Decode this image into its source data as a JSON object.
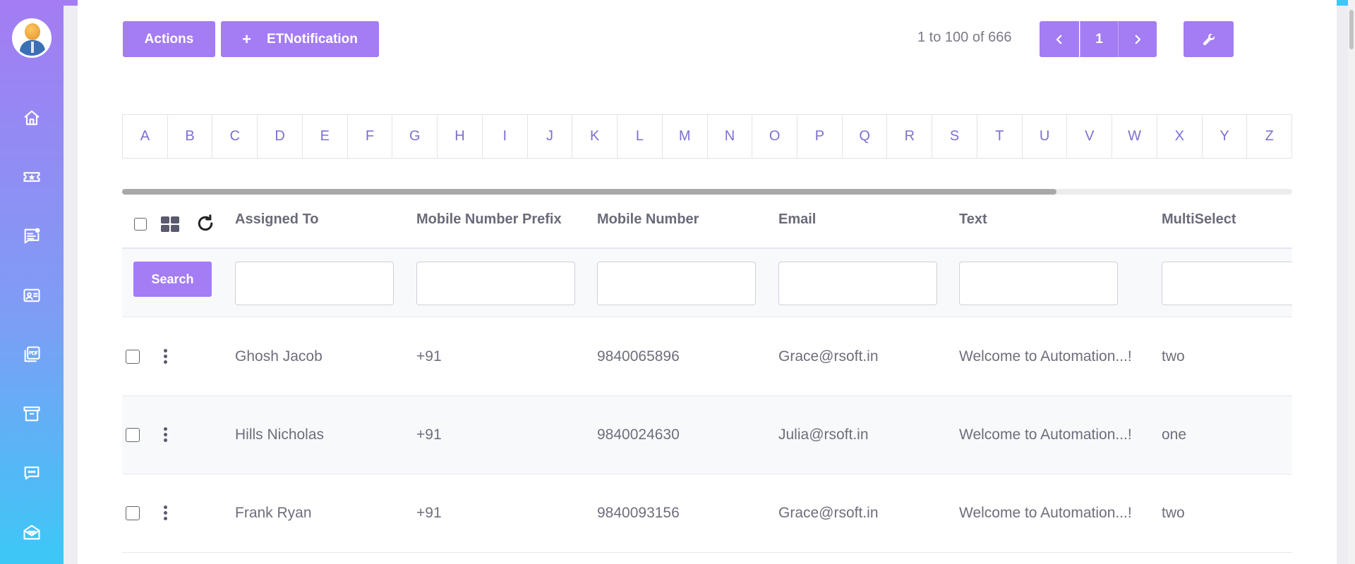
{
  "sidebar": {
    "items": [
      {
        "icon": "home-icon"
      },
      {
        "icon": "ticket-icon"
      },
      {
        "icon": "notes-icon"
      },
      {
        "icon": "contact-card-icon"
      },
      {
        "icon": "pdf-icon"
      },
      {
        "icon": "archive-icon"
      },
      {
        "icon": "chat-icon"
      },
      {
        "icon": "mail-open-icon"
      }
    ]
  },
  "toolbar": {
    "actions_label": "Actions",
    "etn_label": "ETNotification",
    "etn_icon": "+"
  },
  "pager": {
    "range_text": "1 to 100 of 666",
    "current_page": "1"
  },
  "alphabet": [
    "A",
    "B",
    "C",
    "D",
    "E",
    "F",
    "G",
    "H",
    "I",
    "J",
    "K",
    "L",
    "M",
    "N",
    "O",
    "P",
    "Q",
    "R",
    "S",
    "T",
    "U",
    "V",
    "W",
    "X",
    "Y",
    "Z"
  ],
  "table": {
    "columns": [
      "Assigned To",
      "Mobile Number Prefix",
      "Mobile Number",
      "Email",
      "Text",
      "MultiSelect"
    ],
    "search_label": "Search",
    "rows": [
      {
        "assigned_to": "Ghosh Jacob",
        "prefix": "+91",
        "mobile": "9840065896",
        "email": "Grace@rsoft.in",
        "text": "Welcome to Automation...!",
        "multiselect": "two"
      },
      {
        "assigned_to": "Hills Nicholas",
        "prefix": "+91",
        "mobile": "9840024630",
        "email": "Julia@rsoft.in",
        "text": "Welcome to Automation...!",
        "multiselect": "one"
      },
      {
        "assigned_to": "Frank Ryan",
        "prefix": "+91",
        "mobile": "9840093156",
        "email": "Grace@rsoft.in",
        "text": "Welcome to Automation...!",
        "multiselect": "two"
      }
    ]
  },
  "colors": {
    "accent": "#a47cf3",
    "sidebar_gradient_top": "#a47cf3",
    "sidebar_gradient_bottom": "#3cc8f7",
    "alphabet_text": "#7b70d4"
  }
}
